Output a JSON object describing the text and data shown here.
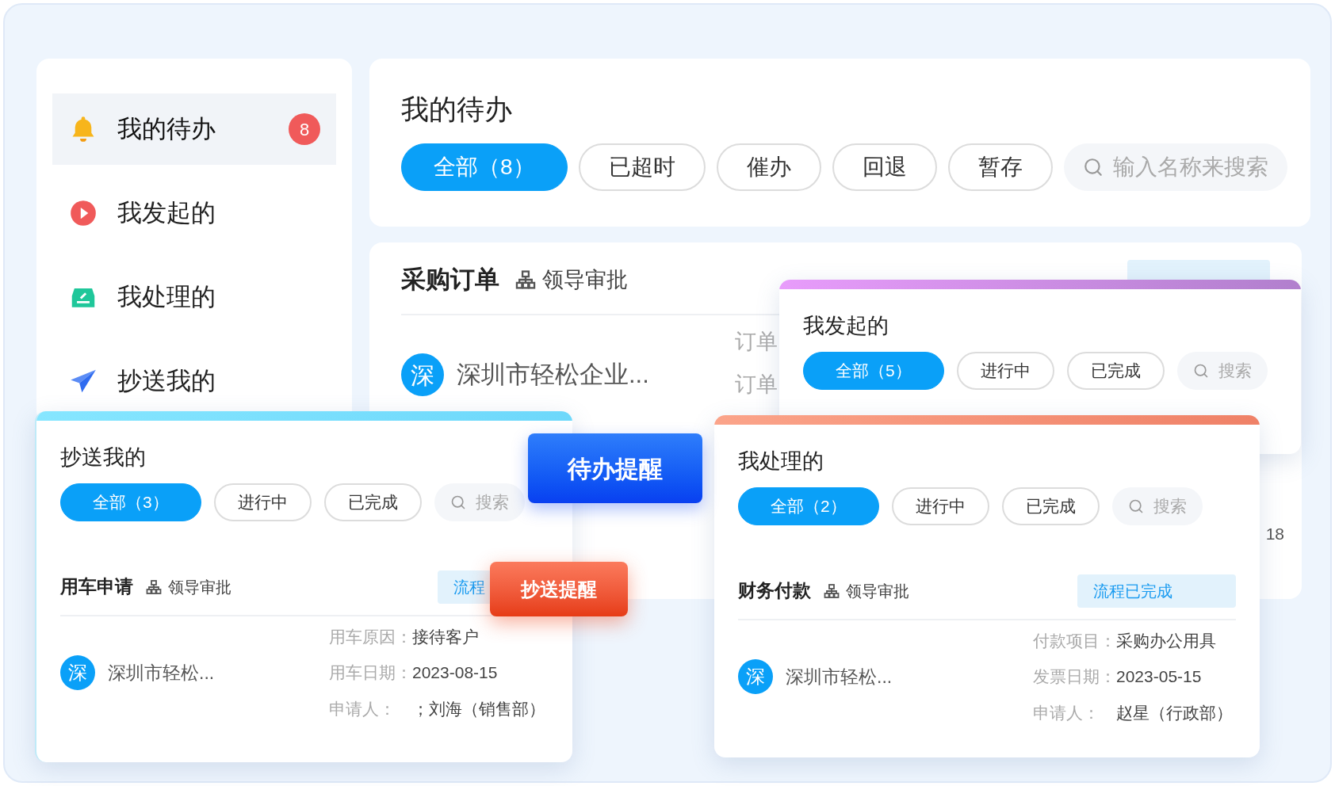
{
  "sidebar": {
    "items": [
      {
        "label": "我的待办",
        "kind": "bell",
        "badge": "8",
        "selected": true
      },
      {
        "label": "我发起的",
        "kind": "play",
        "selected": false
      },
      {
        "label": "我处理的",
        "kind": "tray",
        "selected": false
      },
      {
        "label": "抄送我的",
        "kind": "send",
        "selected": false
      }
    ]
  },
  "todo_panel": {
    "title": "我的待办",
    "filters": [
      {
        "label": "全部（8）",
        "selected": true
      },
      {
        "label": "已超时",
        "selected": false
      },
      {
        "label": "催办",
        "selected": false
      },
      {
        "label": "回退",
        "selected": false
      },
      {
        "label": "暂存",
        "selected": false
      }
    ],
    "search": {
      "placeholder": "输入名称来搜索"
    }
  },
  "order_card": {
    "title": "采购订单",
    "flow": "领导审批",
    "avatar": "深",
    "company": "深圳市轻松企业...",
    "field_labels": [
      "订单",
      "订单"
    ],
    "fragment": "18"
  },
  "initiated_card": {
    "kind": "purple",
    "title": "我发起的",
    "filters": [
      {
        "label": "全部（5）",
        "selected": true
      },
      {
        "label": "进行中",
        "selected": false
      },
      {
        "label": "已完成",
        "selected": false
      }
    ],
    "search": {
      "placeholder": "搜索"
    }
  },
  "cc_card": {
    "kind": "cyan",
    "title": "抄送我的",
    "filters": [
      {
        "label": "全部（3）",
        "selected": true
      },
      {
        "label": "进行中",
        "selected": false
      },
      {
        "label": "已完成",
        "selected": false
      }
    ],
    "search": {
      "placeholder": "搜索"
    },
    "record": {
      "title": "用车申请",
      "flow": "领导审批",
      "status": "流程",
      "avatar": "深",
      "company": "深圳市轻松...",
      "details": [
        {
          "label": "用车原因：",
          "value": "接待客户"
        },
        {
          "label": "用车日期：",
          "value": "2023-08-15"
        },
        {
          "label": "申请人：",
          "value": "；刘海（销售部）"
        }
      ]
    }
  },
  "reminders": [
    {
      "kind": "todo",
      "label": "待办提醒"
    },
    {
      "kind": "cc",
      "label": "抄送提醒"
    }
  ],
  "handled_card": {
    "kind": "orange",
    "title": "我处理的",
    "filters": [
      {
        "label": "全部（2）",
        "selected": true
      },
      {
        "label": "进行中",
        "selected": false
      },
      {
        "label": "已完成",
        "selected": false
      }
    ],
    "search": {
      "placeholder": "搜索"
    },
    "record": {
      "title": "财务付款",
      "flow": "领导审批",
      "status": "流程已完成",
      "avatar": "深",
      "company": "深圳市轻松...",
      "details": [
        {
          "label": "付款项目：",
          "value": "采购办公用具"
        },
        {
          "label": "发票日期：",
          "value": "2023-05-15"
        },
        {
          "label": "申请人：",
          "value": "赵星（行政部）"
        }
      ]
    }
  }
}
